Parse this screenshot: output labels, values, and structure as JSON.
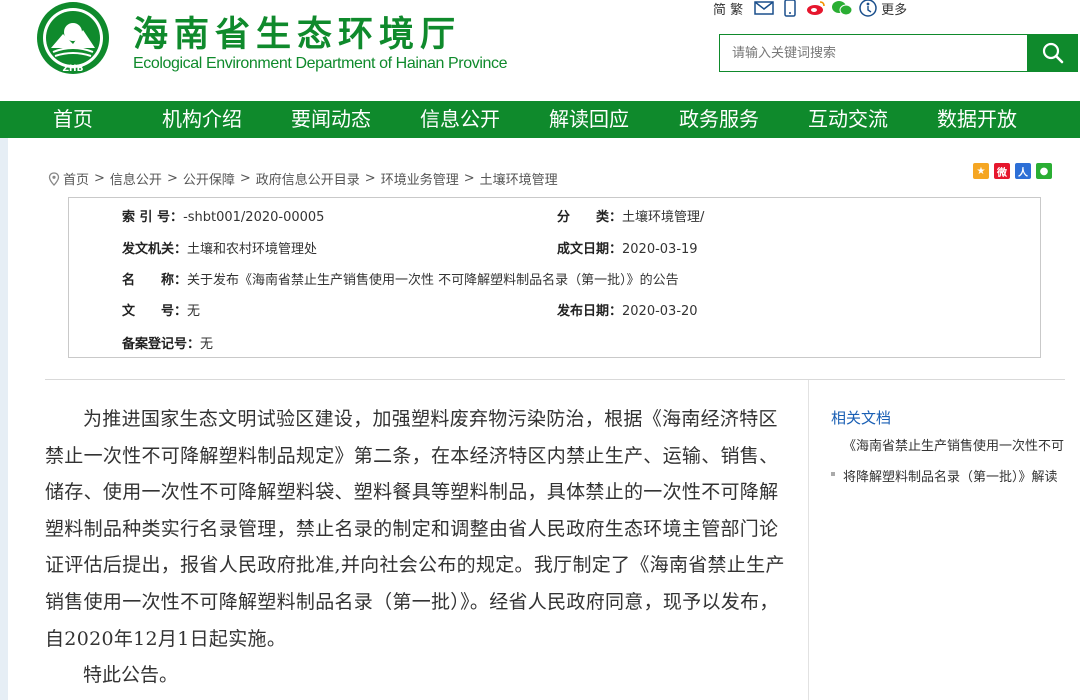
{
  "header": {
    "title_cn": "海南省生态环境厅",
    "title_en": "Ecological Environment Department of Hainan Province",
    "logo_text": "ZHB",
    "lang_label": "简 繁",
    "more_label": "更多",
    "search_placeholder": "请输入关键词搜索",
    "brand_color": "#0f8a2c"
  },
  "nav": {
    "items": [
      "首页",
      "机构介绍",
      "要闻动态",
      "信息公开",
      "解读回应",
      "政务服务",
      "互动交流",
      "数据开放"
    ]
  },
  "breadcrumb": {
    "items": [
      "首页",
      "信息公开",
      "公开保障",
      "政府信息公开目录",
      "环境业务管理",
      "土壤环境管理"
    ],
    "separator": ">"
  },
  "info": {
    "index_label": "索 引 号：",
    "index_value": "-shbt001/2020-00005",
    "category_label": "分　　类：",
    "category_value": "土壤环境管理/",
    "issuer_label": "发文机关：",
    "issuer_value": "土壤和农村环境管理处",
    "created_label": "成文日期：",
    "created_value": "2020-03-19",
    "name_label": "名　　称：",
    "name_value": "关于发布《海南省禁止生产销售使用一次性 不可降解塑料制品名录（第一批）》的公告",
    "docno_label": "文　　号：",
    "docno_value": "无",
    "published_label": "发布日期：",
    "published_value": "2020-03-20",
    "record_label": "备案登记号：",
    "record_value": "无"
  },
  "article": {
    "paragraph1": "为推进国家生态文明试验区建设，加强塑料废弃物污染防治，根据《海南经济特区禁止一次性不可降解塑料制品规定》第二条，在本经济特区内禁止生产、运输、销售、储存、使用一次性不可降解塑料袋、塑料餐具等塑料制品，具体禁止的一次性不可降解塑料制品种类实行名录管理，禁止名录的制定和调整由省人民政府生态环境主管部门论证评估后提出，报省人民政府批准,并向社会公布的规定。我厅制定了《海南省禁止生产销售使用一次性不可降解塑料制品名录（第一批）》。经省人民政府同意，现予以发布，自2020年12月1日起实施。",
    "paragraph2": "特此公告。"
  },
  "related": {
    "title": "相关文档",
    "items": [
      "《海南省禁止生产销售使用一次性不可将降解塑料制品名录（第一批）》解读"
    ]
  }
}
